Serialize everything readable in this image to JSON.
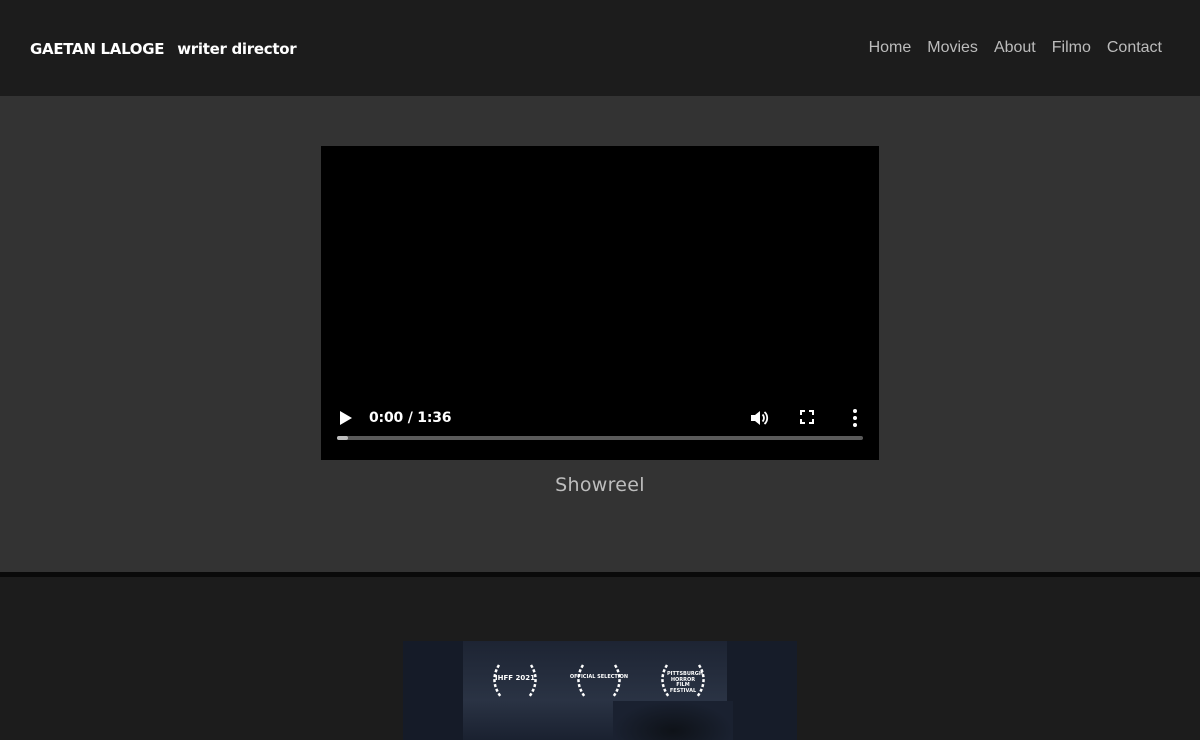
{
  "header": {
    "name": "GAETAN LALOGE",
    "role": "writer director",
    "nav": [
      "Home",
      "Movies",
      "About",
      "Filmo",
      "Contact"
    ]
  },
  "video": {
    "time": "0:00 / 1:36",
    "progress": 0.02
  },
  "caption": "Showreel",
  "poster": {
    "laurels": [
      "IHFF 2021",
      "OFFICIAL SELECTION",
      "PITTSBURGH HORROR FILM FESTIVAL"
    ]
  },
  "icons": [
    "play-icon",
    "volume-icon",
    "fullscreen-icon",
    "more-vertical-icon",
    "laurel-icon"
  ],
  "colors": {
    "header_bg": "#1c1c1c",
    "hero_bg": "#333333",
    "nav_text": "#bcbcbc",
    "caption_text": "#bdbdbd"
  }
}
